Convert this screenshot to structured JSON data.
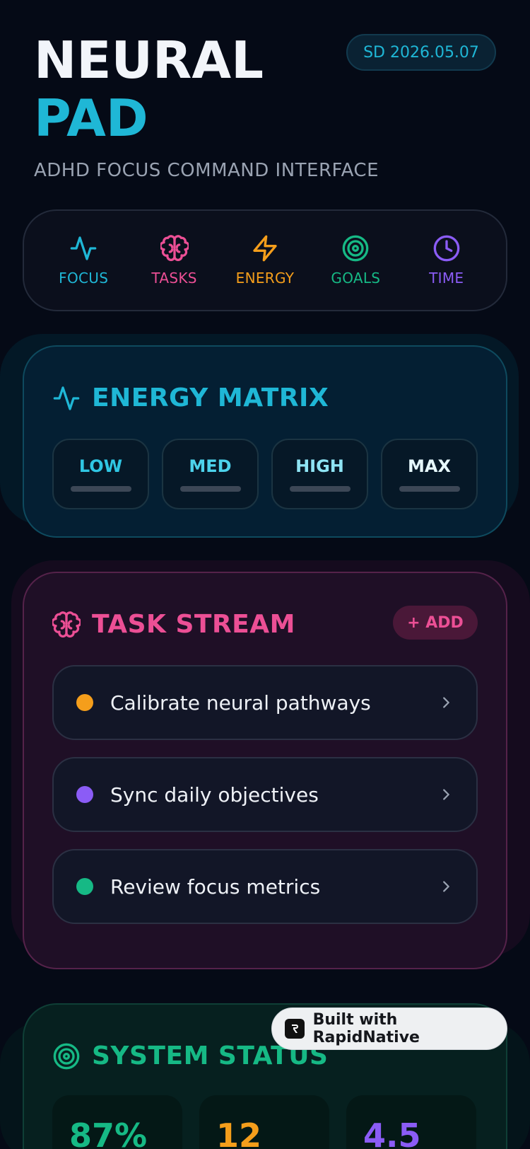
{
  "app": {
    "title_line1": "NEURAL",
    "title_line2": "PAD",
    "subtitle": "ADHD FOCUS COMMAND INTERFACE",
    "date": "SD 2026.05.07"
  },
  "nav": {
    "items": [
      {
        "label": "FOCUS",
        "icon": "activity-icon",
        "color": "#1fb7d6"
      },
      {
        "label": "TASKS",
        "icon": "brain-icon",
        "color": "#ec4f95"
      },
      {
        "label": "ENERGY",
        "icon": "lightning-icon",
        "color": "#f59e1b"
      },
      {
        "label": "GOALS",
        "icon": "target-icon",
        "color": "#16b985"
      },
      {
        "label": "TIME",
        "icon": "clock-icon",
        "color": "#8b5cf6"
      }
    ]
  },
  "energy": {
    "title": "ENERGY MATRIX",
    "color": "#1fb7d6",
    "levels": [
      "LOW",
      "MED",
      "HIGH",
      "MAX"
    ]
  },
  "tasks": {
    "title": "TASK STREAM",
    "color": "#ec4f95",
    "add_label": "+ ADD",
    "items": [
      {
        "text": "Calibrate neural pathways",
        "color": "#f59e1b"
      },
      {
        "text": "Sync daily objectives",
        "color": "#8b5cf6"
      },
      {
        "text": "Review focus metrics",
        "color": "#16b985"
      }
    ]
  },
  "status": {
    "title": "SYSTEM STATUS",
    "color": "#16b985",
    "stats": [
      {
        "value": "87%",
        "color": "#16b985"
      },
      {
        "value": "12",
        "color": "#f59e1b"
      },
      {
        "value": "4.5",
        "color": "#8b5cf6"
      }
    ]
  },
  "badge": {
    "text": "Built with RapidNative"
  }
}
